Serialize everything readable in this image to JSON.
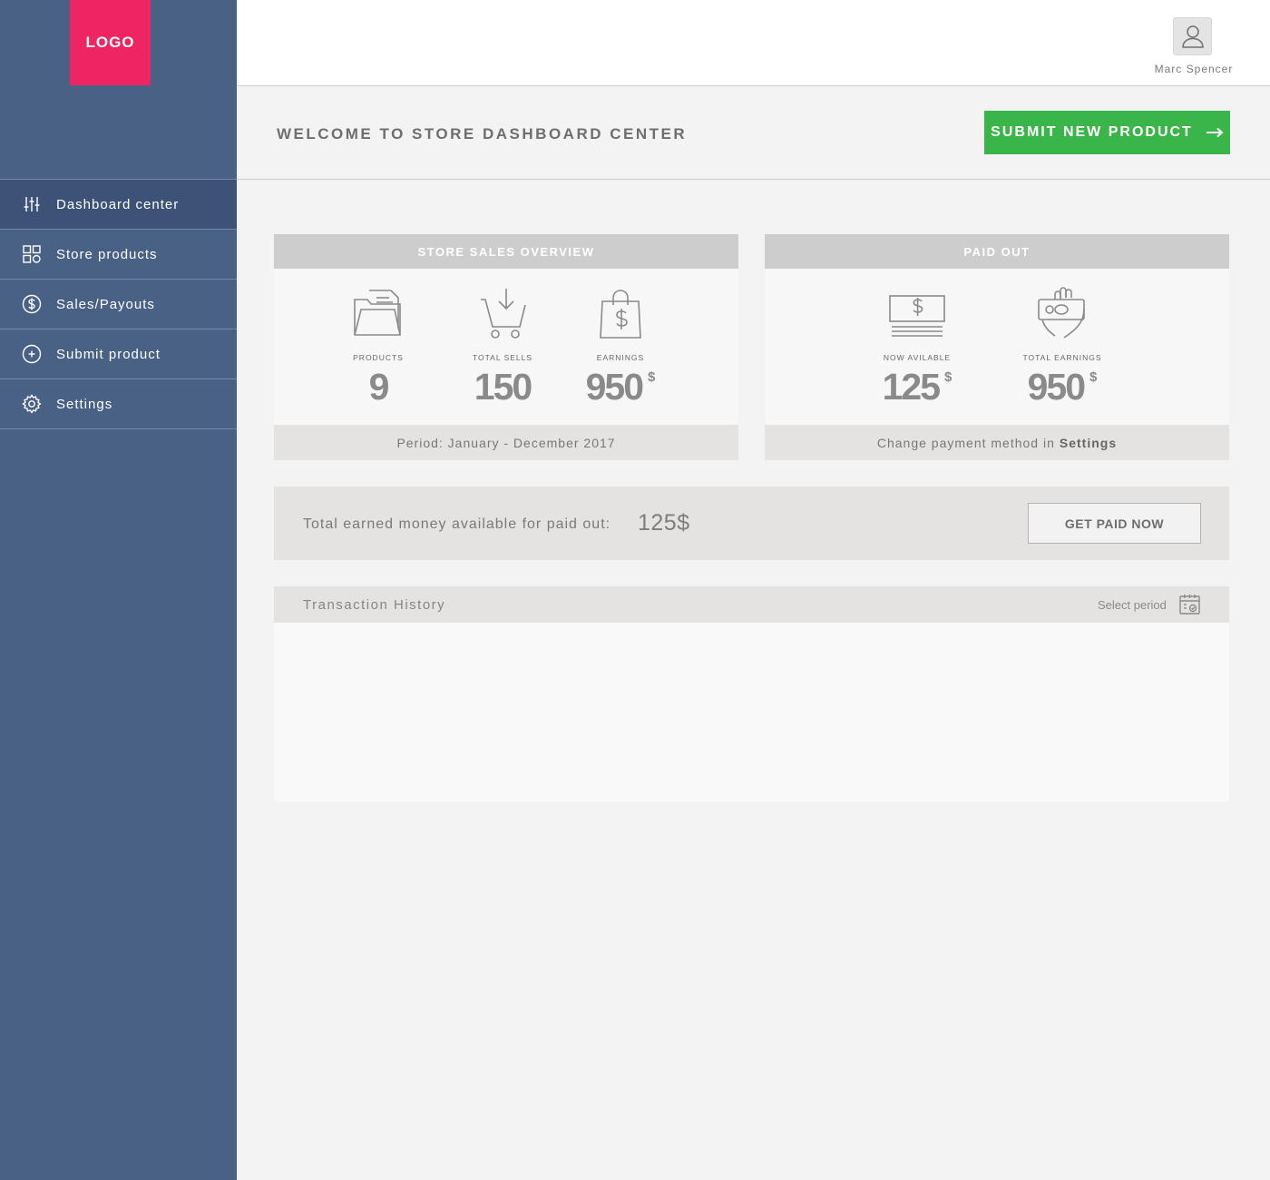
{
  "logo": "LOGO",
  "sidebar": {
    "items": [
      {
        "label": "Dashboard center",
        "icon": "sliders-icon",
        "active": true
      },
      {
        "label": "Store products",
        "icon": "grid-icon"
      },
      {
        "label": "Sales/Payouts",
        "icon": "dollar-circle-icon"
      },
      {
        "label": "Submit product",
        "icon": "plus-circle-icon"
      },
      {
        "label": "Settings",
        "icon": "gear-icon"
      }
    ]
  },
  "user": {
    "name": "Marc Spencer"
  },
  "header": {
    "title": "WELCOME TO STORE DASHBOARD CENTER",
    "submit_label": "SUBMIT NEW PRODUCT"
  },
  "sales_card": {
    "title": "STORE SALES OVERVIEW",
    "stats": [
      {
        "label": "PRODUCTS",
        "value": "9",
        "icon": "folder-icon"
      },
      {
        "label": "TOTAL SELLS",
        "value": "150",
        "icon": "cart-icon"
      },
      {
        "label": "EARNINGS",
        "value": "950",
        "unit": "$",
        "icon": "shopping-bag-icon"
      }
    ],
    "footer": "Period: January - December 2017"
  },
  "paid_card": {
    "title": "PAID OUT",
    "stats": [
      {
        "label": "NOW AVILABLE",
        "value": "125",
        "unit": "$",
        "icon": "banknote-icon"
      },
      {
        "label": "TOTAL EARNINGS",
        "value": "950",
        "unit": "$",
        "icon": "hand-money-icon"
      }
    ],
    "footer_prefix": "Change payment method in",
    "footer_link": "Settings"
  },
  "payout": {
    "text": "Total earned money available for paid out:",
    "amount": "125$",
    "button": "GET PAID NOW"
  },
  "transactions": {
    "title": "Transaction History",
    "period_label": "Select period",
    "calendar_icon": "calendar-icon"
  },
  "colors": {
    "sidebar": "#4a6186",
    "logo": "#ee2562",
    "accent_green": "#3ab54a"
  }
}
